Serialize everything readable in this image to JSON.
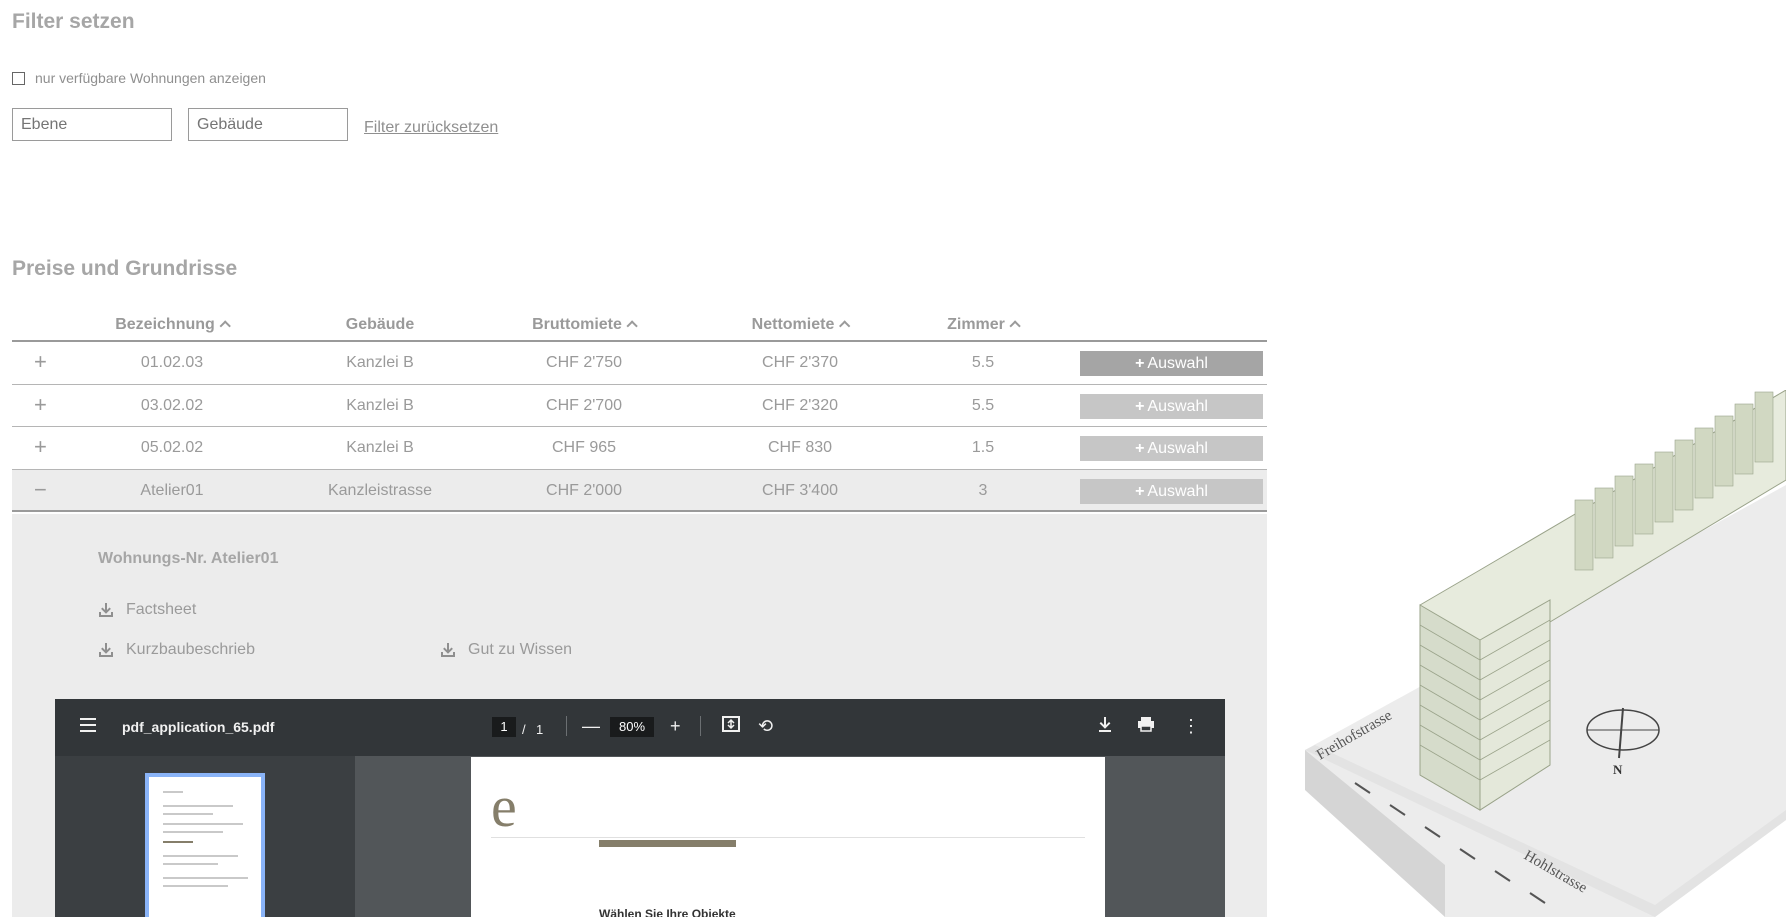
{
  "filter": {
    "title": "Filter setzen",
    "available_only_label": "nur verfügbare Wohnungen anzeigen",
    "level_placeholder": "Ebene",
    "building_placeholder": "Gebäude",
    "reset_label": "Filter zurücksetzen"
  },
  "section": {
    "title": "Preise und Grundrisse"
  },
  "table": {
    "headers": {
      "name": "Bezeichnung",
      "building": "Gebäude",
      "gross": "Bruttomiete",
      "net": "Nettomiete",
      "rooms": "Zimmer"
    },
    "select_label": "Auswahl",
    "rows": [
      {
        "toggle": "+",
        "name": "01.02.03",
        "building": "Kanzlei B",
        "gross": "CHF 2'750",
        "net": "CHF 2'370",
        "rooms": "5.5"
      },
      {
        "toggle": "+",
        "name": "03.02.02",
        "building": "Kanzlei B",
        "gross": "CHF 2'700",
        "net": "CHF 2'320",
        "rooms": "5.5"
      },
      {
        "toggle": "+",
        "name": "05.02.02",
        "building": "Kanzlei B",
        "gross": "CHF 965",
        "net": "CHF 830",
        "rooms": "1.5"
      },
      {
        "toggle": "−",
        "name": "Atelier01",
        "building": "Kanzleistrasse",
        "gross": "CHF 2'000",
        "net": "CHF 3'400",
        "rooms": "3"
      }
    ]
  },
  "detail": {
    "title": "Wohnungs-Nr. Atelier01",
    "downloads": [
      "Factsheet",
      "Kurzbaubeschrieb",
      "Gut zu Wissen"
    ]
  },
  "pdf_viewer": {
    "filename": "pdf_application_65.pdf",
    "page_current": "1",
    "page_separator": "/",
    "page_total": "1",
    "zoom": "80%",
    "logo_letter": "e",
    "body_heading": "Wählen Sie Ihre Objekte"
  },
  "map": {
    "street_1": "Freihofstrasse",
    "street_2": "Hohlstrasse",
    "compass": "N"
  }
}
